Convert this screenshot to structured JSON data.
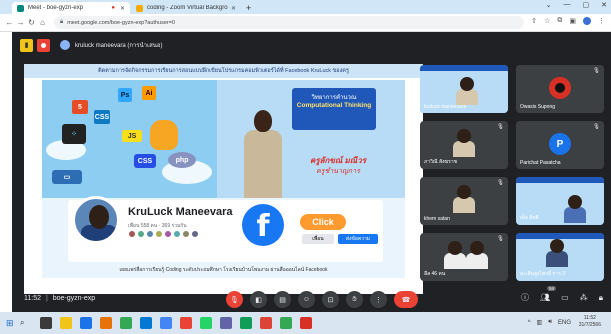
{
  "browser": {
    "tabs": [
      {
        "title": "Meet - boe-gyzn-exp",
        "active": true,
        "favicon_color": "#00897b"
      },
      {
        "title": "coding - Zoom Virtual Backgrou",
        "active": false,
        "favicon_color": "#f9ab00"
      }
    ],
    "new_tab": "+",
    "url": "meet.google.com/boe-gyzn-exp?authuser=0"
  },
  "meet": {
    "presenter": "kruluck maneevara (การนำเสนอ)",
    "slide": {
      "top_text": "ติดตามการจัดกิจกรรมการเรียนการสอนแบบฝึกเขียนโปรแกรมคอมพิวเตอร์ได้ที่ Facebook KruLuck ของครู",
      "cd_title": "วิทยาการคำนวณ",
      "cd_subtitle": "Computational Thinking",
      "teacher_th": "ครูลักขณ์  มณีวร",
      "teacher_th_role": "ครูชำนาญการ",
      "profile_name": "KruLuck Maneevara",
      "profile_meta": "เพื่อน 558 คน · 369 ร่วมกัน",
      "fb_logo": "f",
      "click": "Click",
      "btn_friend": "เพื่อน",
      "btn_message": "ส่งข้อความ",
      "bottom_text": "เผยแพร่สื่อการเรียนรู้ Coding ระดับประถมศึกษา โรงเรียนบ้านโพนงาม  ผ่านสื่อออนไลน์ Facebook"
    },
    "participants": [
      {
        "name": "kruluck maneevara",
        "type": "slide"
      },
      {
        "name": "Owasis Supong",
        "type": "avatar",
        "color": "#d93025",
        "initial": ""
      },
      {
        "name": "ภาวิณี สังฆราช",
        "type": "face"
      },
      {
        "name": "Parichat Pasatcha",
        "type": "avatar",
        "color": "#1a73e8",
        "initial": "P"
      },
      {
        "name": "khem satan",
        "type": "face"
      },
      {
        "name": "เด็จ สิทธิ",
        "type": "slide"
      },
      {
        "name": "ลีล 46 คน",
        "type": "face2"
      },
      {
        "name": "ละเลิ่นสูงไพรสี การ 3",
        "type": "slide2"
      }
    ],
    "meeting_time": "11:52",
    "meeting_code": "boe-gyzn-exp",
    "participant_count": "54"
  },
  "taskbar": {
    "time": "11:52",
    "date": "31/7/2566",
    "lang": "ENG",
    "icon_colors": [
      "#3b3b3b",
      "#f0c419",
      "#1a73e8",
      "#e8710a",
      "#34a853",
      "#0078d4",
      "#4285f4",
      "#ea4335",
      "#25d366",
      "#6264a7",
      "#0f9d58",
      "#db4437",
      "#34a853",
      "#d93025"
    ]
  }
}
